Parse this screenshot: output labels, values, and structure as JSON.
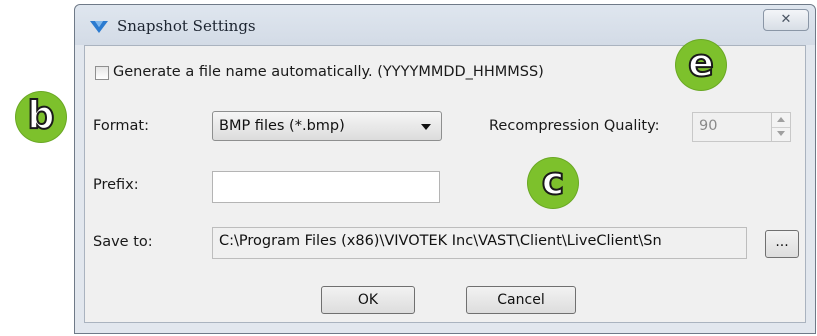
{
  "window": {
    "title": "Snapshot Settings",
    "close_glyph": "✕"
  },
  "auto_name": {
    "checked": false,
    "label": "Generate a file name automatically. (YYYYMMDD_HHMMSS)"
  },
  "format": {
    "label": "Format:",
    "selected": "BMP files (*.bmp)"
  },
  "quality": {
    "label": "Recompression Quality:",
    "value": "90"
  },
  "prefix": {
    "label": "Prefix:",
    "value": ""
  },
  "save_to": {
    "label": "Save to:",
    "path": "C:\\Program Files (x86)\\VIVOTEK Inc\\VAST\\Client\\LiveClient\\Sn",
    "browse_label": "..."
  },
  "buttons": {
    "ok": "OK",
    "cancel": "Cancel"
  },
  "callouts": {
    "b": "b",
    "c": "c",
    "e": "e",
    "color": "#7dc12c"
  }
}
